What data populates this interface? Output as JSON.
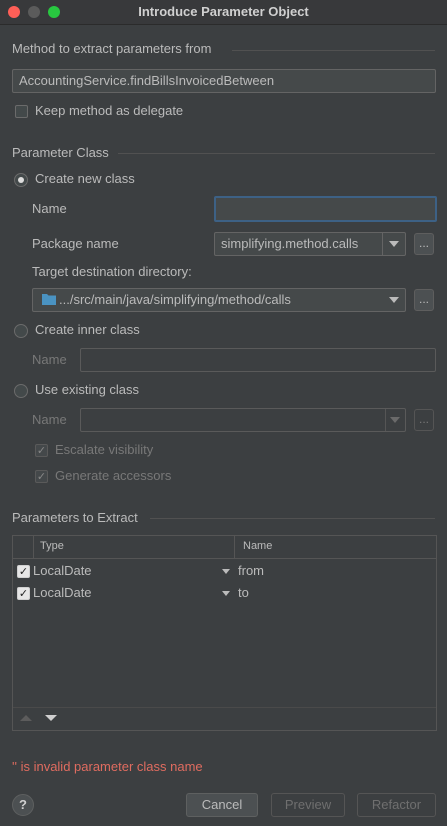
{
  "window": {
    "title": "Introduce Parameter Object"
  },
  "method_section": {
    "title": "Method to extract parameters from",
    "method_value": "AccountingService.findBillsInvoicedBetween",
    "keep_delegate_label": "Keep method as delegate"
  },
  "param_class": {
    "title": "Parameter Class",
    "create_new_label": "Create new class",
    "name_label": "Name",
    "name_value": "",
    "package_label": "Package name",
    "package_value": "simplifying.method.calls",
    "target_dir_label": "Target destination directory:",
    "target_dir_value": ".../src/main/java/simplifying/method/calls",
    "browse_label": "...",
    "create_inner_label": "Create inner class",
    "inner_name_label": "Name",
    "use_existing_label": "Use existing class",
    "existing_name_label": "Name",
    "escalate_label": "Escalate visibility",
    "generate_accessors_label": "Generate accessors"
  },
  "params_section": {
    "title": "Parameters to Extract",
    "columns": [
      "Type",
      "Name"
    ],
    "rows": [
      {
        "type": "LocalDate",
        "name": "from"
      },
      {
        "type": "LocalDate",
        "name": "to"
      }
    ]
  },
  "error_message": "'' is invalid parameter class name",
  "footer": {
    "help_label": "?",
    "cancel_label": "Cancel",
    "preview_label": "Preview",
    "refactor_label": "Refactor"
  },
  "colors": {
    "error": "#e06c60",
    "focus": "#3d6185",
    "close": "#ff5f57",
    "minimize": "#febc2e",
    "maximize": "#28c840"
  }
}
